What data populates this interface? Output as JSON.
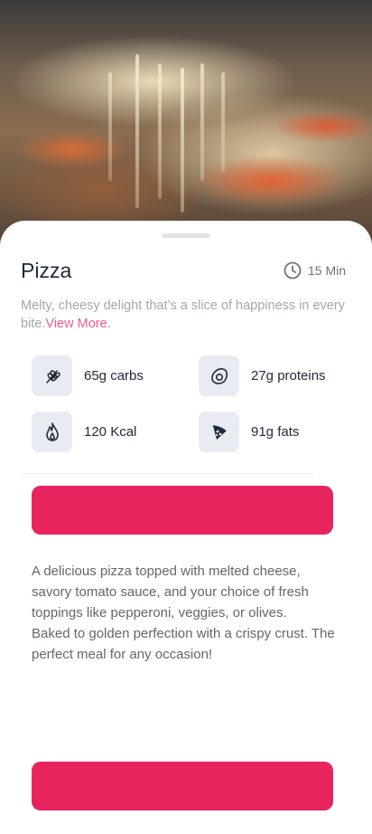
{
  "hero": {
    "image": "pizza-photo"
  },
  "recipe": {
    "title": "Pizza",
    "time": "15 Min",
    "description": "Melty, cheesy delight that’s a slice of happiness in every bite.",
    "view_more": "View More."
  },
  "nutrition": [
    {
      "icon": "wheat-icon",
      "label": "65g carbs"
    },
    {
      "icon": "egg-icon",
      "label": "27g proteins"
    },
    {
      "icon": "flame-icon",
      "label": "120 Kcal"
    },
    {
      "icon": "pizza-slice-icon",
      "label": "91g fats"
    }
  ],
  "buttons": {
    "primary_label": "",
    "secondary_label": ""
  },
  "details": "A delicious pizza topped with melted cheese, savory tomato sauce, and your choice of fresh toppings like pepperoni, veggies, or olives.\n Baked to golden perfection with a crispy crust. The perfect meal for any occasion!",
  "colors": {
    "accent": "#e8245e",
    "link": "#ee5b8a",
    "title": "#1e2a3b",
    "muted": "#a3a7ae",
    "icon_bg": "#e8ecf2"
  }
}
